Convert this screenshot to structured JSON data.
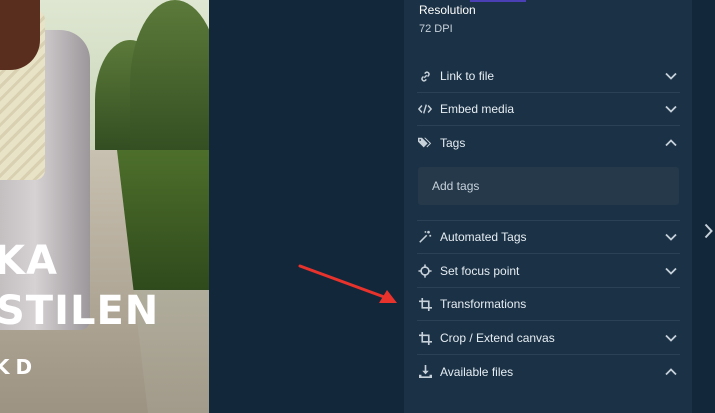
{
  "photo": {
    "text_line_1": "KA",
    "text_line_2": "STILEN",
    "text_line_3": "KD"
  },
  "panel": {
    "resolution_label": "Resolution",
    "resolution_value": "72 DPI",
    "sections": [
      {
        "label": "Link to file",
        "icon": "link-icon",
        "state": "collapsed"
      },
      {
        "label": "Embed media",
        "icon": "code-icon",
        "state": "collapsed"
      },
      {
        "label": "Tags",
        "icon": "tag-icon",
        "state": "expanded"
      },
      {
        "label": "Automated Tags",
        "icon": "magic-wand-icon",
        "state": "collapsed"
      },
      {
        "label": "Set focus point",
        "icon": "crosshair-icon",
        "state": "collapsed"
      },
      {
        "label": "Transformations",
        "icon": "crop-icon",
        "state": "none"
      },
      {
        "label": "Crop / Extend canvas",
        "icon": "crop-icon",
        "state": "collapsed"
      },
      {
        "label": "Available files",
        "icon": "download-icon",
        "state": "expanded"
      }
    ],
    "tags_input_placeholder": "Add tags"
  },
  "colors": {
    "background": "#13273a",
    "panel": "#1b3145",
    "annotation_arrow": "#e8322c"
  }
}
